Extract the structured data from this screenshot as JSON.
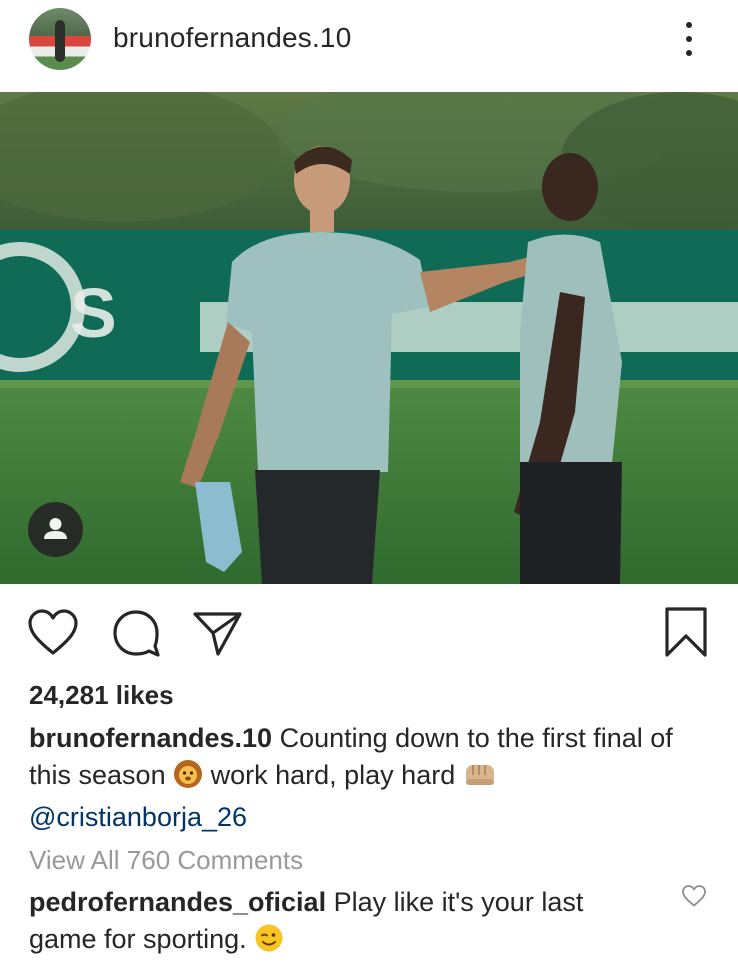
{
  "post": {
    "username": "brunofernandes.10",
    "likes": "24,281 likes",
    "caption": {
      "username": "brunofernandes.10",
      "text_part1": " Counting down to the first final of this season ",
      "emoji1": "lion-face-icon",
      "text_part2": " work hard, play hard ",
      "emoji2": "fist-bump-icon",
      "mention": "@cristianborja_26"
    },
    "view_all_comments": "View All 760 Comments",
    "comments": [
      {
        "username": "pedrofernandes_oficial",
        "text": " Play like it's your last game for sporting. ",
        "emoji": "winking-face-icon"
      }
    ]
  },
  "icons": {
    "menu": "more-vertical-icon",
    "user_tag": "person-tag-icon",
    "like": "heart-icon",
    "comment": "comment-bubble-icon",
    "share": "paper-plane-icon",
    "save": "bookmark-icon",
    "comment_like": "heart-icon"
  },
  "colors": {
    "text": "#262626",
    "secondary_text": "#999999",
    "mention": "#003569",
    "background": "#ffffff"
  }
}
